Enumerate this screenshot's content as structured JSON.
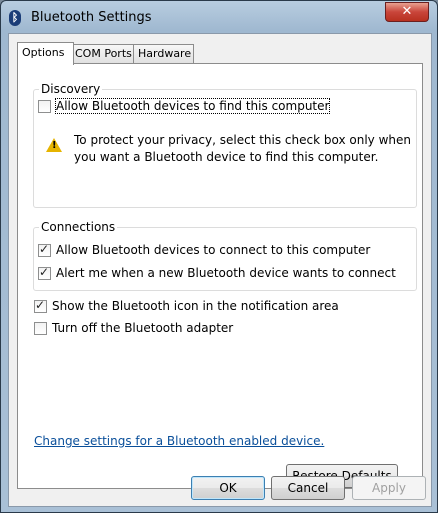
{
  "window": {
    "title": "Bluetooth Settings",
    "close_label": "✕"
  },
  "tabs": [
    {
      "label": "Options"
    },
    {
      "label": "COM Ports"
    },
    {
      "label": "Hardware"
    }
  ],
  "discovery": {
    "legend": "Discovery",
    "allow_find_label": "Allow Bluetooth devices to find this computer",
    "allow_find_checked": false,
    "warning_line1": "To protect your privacy, select this check box only when",
    "warning_line2": "you want a Bluetooth device to find this computer."
  },
  "connections": {
    "legend": "Connections",
    "allow_connect_label": "Allow Bluetooth devices to connect to this computer",
    "allow_connect_checked": true,
    "alert_label": "Alert me when a new Bluetooth device wants to connect",
    "alert_checked": true
  },
  "show_icon_label": "Show the Bluetooth icon in the notification area",
  "show_icon_checked": true,
  "turn_off_label": "Turn off the Bluetooth adapter",
  "turn_off_checked": false,
  "change_settings_link": "Change settings for a Bluetooth enabled device.",
  "buttons": {
    "restore": "Restore Defaults",
    "ok": "OK",
    "cancel": "Cancel",
    "apply": "Apply"
  }
}
